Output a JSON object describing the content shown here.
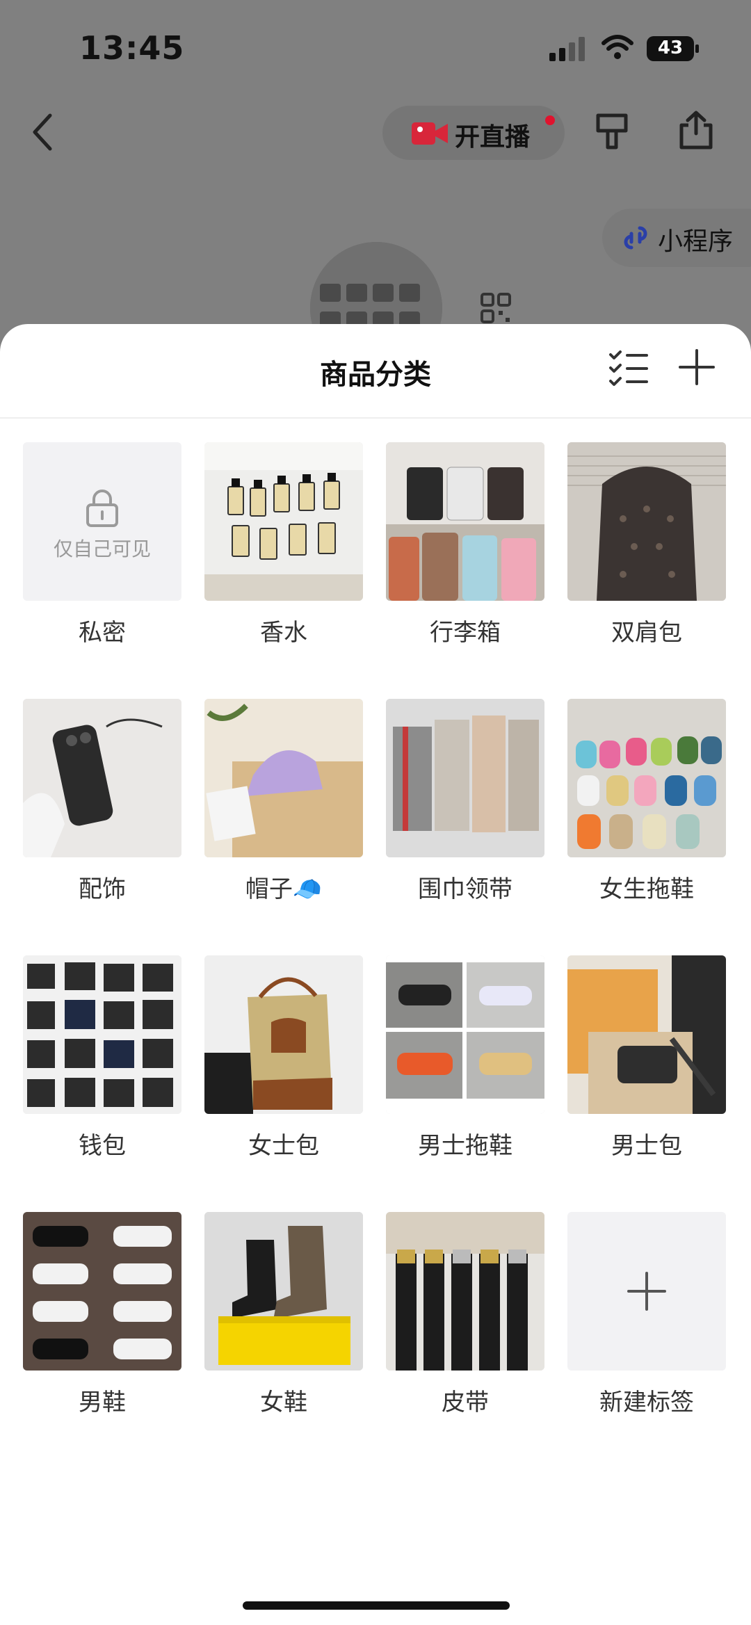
{
  "status_bar": {
    "time": "13:45",
    "battery": "43"
  },
  "header": {
    "live_label": "开直播",
    "mini_program_label": "小程序"
  },
  "sheet": {
    "title": "商品分类",
    "categories": [
      {
        "label": "私密",
        "private_hint": "仅自己可见"
      },
      {
        "label": "香水"
      },
      {
        "label": "行李箱"
      },
      {
        "label": "双肩包"
      },
      {
        "label": "配饰"
      },
      {
        "label": "帽子🧢"
      },
      {
        "label": "围巾领带"
      },
      {
        "label": "女生拖鞋"
      },
      {
        "label": "钱包"
      },
      {
        "label": "女士包"
      },
      {
        "label": "男士拖鞋"
      },
      {
        "label": "男士包"
      },
      {
        "label": "男鞋"
      },
      {
        "label": "女鞋"
      },
      {
        "label": "皮带"
      },
      {
        "label": "新建标签"
      }
    ]
  },
  "colors": {
    "overlay": "#808080",
    "sheet_bg": "#ffffff",
    "live_dot": "#e0132e",
    "placeholder_bg": "#f2f2f4"
  }
}
